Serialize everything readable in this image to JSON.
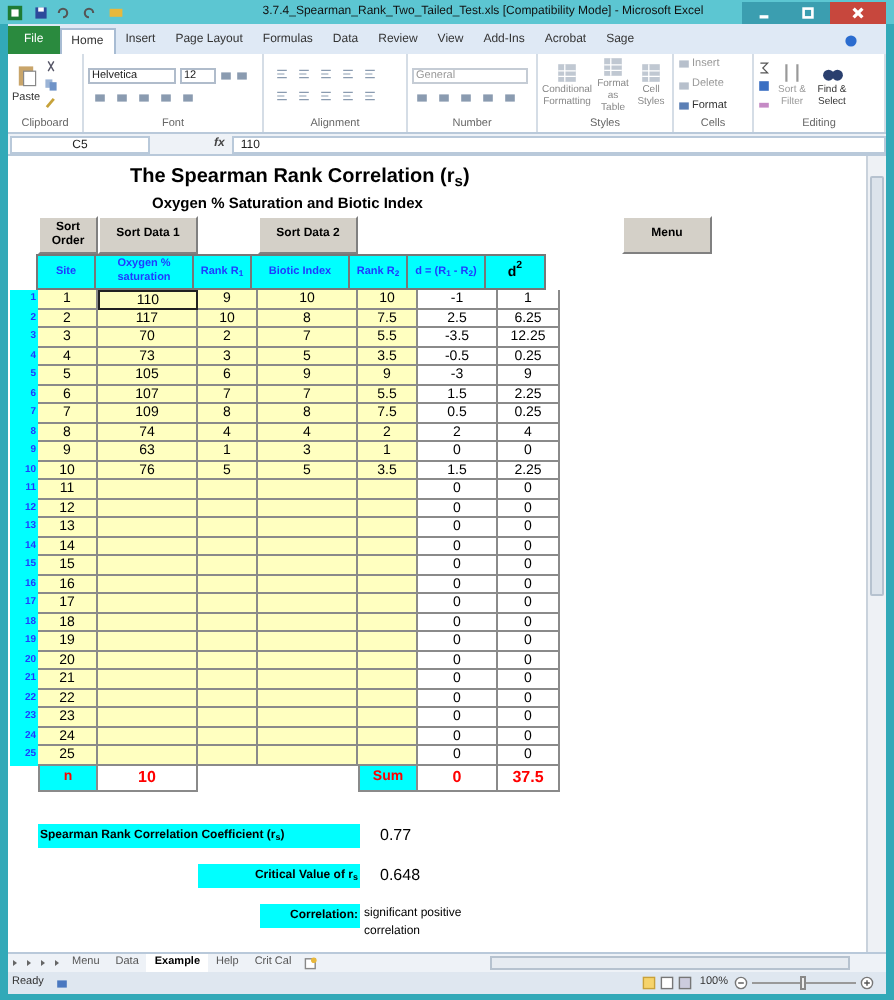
{
  "window": {
    "title": "3.7.4_Spearman_Rank_Two_Tailed_Test.xls  [Compatibility Mode]  -  Microsoft Excel"
  },
  "ribbon_tabs": [
    {
      "label": "File",
      "selected": false,
      "kind": "file"
    },
    {
      "label": "Home",
      "selected": true,
      "kind": "tab"
    },
    {
      "label": "Insert",
      "selected": false,
      "kind": "tab"
    },
    {
      "label": "Page Layout",
      "selected": false,
      "kind": "tab"
    },
    {
      "label": "Formulas",
      "selected": false,
      "kind": "tab"
    },
    {
      "label": "Data",
      "selected": false,
      "kind": "tab"
    },
    {
      "label": "Review",
      "selected": false,
      "kind": "tab"
    },
    {
      "label": "View",
      "selected": false,
      "kind": "tab"
    },
    {
      "label": "Add-Ins",
      "selected": false,
      "kind": "tab"
    },
    {
      "label": "Acrobat",
      "selected": false,
      "kind": "tab"
    },
    {
      "label": "Sage",
      "selected": false,
      "kind": "tab"
    }
  ],
  "ribbon": {
    "paste": "Paste",
    "font_name": "Helvetica",
    "font_size": "12",
    "number_format": "General",
    "styles_buttons": [
      "Conditional Formatting",
      "Format as Table",
      "Cell Styles"
    ],
    "cells_buttons": [
      "Insert",
      "Delete",
      "Format"
    ],
    "editing_buttons": [
      "Sort & Filter",
      "Find & Select"
    ],
    "groups": [
      {
        "label": "Clipboard"
      },
      {
        "label": "Font"
      },
      {
        "label": "Alignment"
      },
      {
        "label": "Number"
      },
      {
        "label": "Styles"
      },
      {
        "label": "Cells"
      },
      {
        "label": "Editing"
      }
    ]
  },
  "formula_bar": {
    "name_box": "C5",
    "fx": "fx",
    "value": "110"
  },
  "sheet": {
    "title": "The Spearman Rank Correlation (r$_{s}$)",
    "subtitle": "Oxygen % Saturation and Biotic Index",
    "buttons": [
      "Sort Order",
      "Sort Data 1",
      "Sort Data 2",
      "Menu"
    ],
    "columns": [
      "Site",
      "Oxygen % saturation",
      "Rank R$_{1}$",
      "Biotic Index",
      "Rank R$_{2}$",
      "d = (R$_{1}$ - R$_{2}$)",
      "d$^{2}$"
    ],
    "rows": [
      {
        "number": "1",
        "selected": true,
        "cells": [
          "1",
          "110",
          "9",
          "10",
          "10",
          "-1",
          "1"
        ]
      },
      {
        "number": "2",
        "selected": false,
        "cells": [
          "2",
          "117",
          "10",
          "8",
          "7.5",
          "2.5",
          "6.25"
        ]
      },
      {
        "number": "3",
        "selected": false,
        "cells": [
          "3",
          "70",
          "2",
          "7",
          "5.5",
          "-3.5",
          "12.25"
        ]
      },
      {
        "number": "4",
        "selected": false,
        "cells": [
          "4",
          "73",
          "3",
          "5",
          "3.5",
          "-0.5",
          "0.25"
        ]
      },
      {
        "number": "5",
        "selected": false,
        "cells": [
          "5",
          "105",
          "6",
          "9",
          "9",
          "-3",
          "9"
        ]
      },
      {
        "number": "6",
        "selected": false,
        "cells": [
          "6",
          "107",
          "7",
          "7",
          "5.5",
          "1.5",
          "2.25"
        ]
      },
      {
        "number": "7",
        "selected": false,
        "cells": [
          "7",
          "109",
          "8",
          "8",
          "7.5",
          "0.5",
          "0.25"
        ]
      },
      {
        "number": "8",
        "selected": false,
        "cells": [
          "8",
          "74",
          "4",
          "4",
          "2",
          "2",
          "4"
        ]
      },
      {
        "number": "9",
        "selected": false,
        "cells": [
          "9",
          "63",
          "1",
          "3",
          "1",
          "0",
          "0"
        ]
      },
      {
        "number": "10",
        "selected": false,
        "cells": [
          "10",
          "76",
          "5",
          "5",
          "3.5",
          "1.5",
          "2.25"
        ]
      },
      {
        "number": "11",
        "selected": false,
        "cells": [
          "11",
          null,
          null,
          null,
          null,
          "0",
          "0"
        ]
      },
      {
        "number": "12",
        "selected": false,
        "cells": [
          "12",
          null,
          null,
          null,
          null,
          "0",
          "0"
        ]
      },
      {
        "number": "13",
        "selected": false,
        "cells": [
          "13",
          null,
          null,
          null,
          null,
          "0",
          "0"
        ]
      },
      {
        "number": "14",
        "selected": false,
        "cells": [
          "14",
          null,
          null,
          null,
          null,
          "0",
          "0"
        ]
      },
      {
        "number": "15",
        "selected": false,
        "cells": [
          "15",
          null,
          null,
          null,
          null,
          "0",
          "0"
        ]
      },
      {
        "number": "16",
        "selected": false,
        "cells": [
          "16",
          null,
          null,
          null,
          null,
          "0",
          "0"
        ]
      },
      {
        "number": "17",
        "selected": false,
        "cells": [
          "17",
          null,
          null,
          null,
          null,
          "0",
          "0"
        ]
      },
      {
        "number": "18",
        "selected": false,
        "cells": [
          "18",
          null,
          null,
          null,
          null,
          "0",
          "0"
        ]
      },
      {
        "number": "19",
        "selected": false,
        "cells": [
          "19",
          null,
          null,
          null,
          null,
          "0",
          "0"
        ]
      },
      {
        "number": "20",
        "selected": false,
        "cells": [
          "20",
          null,
          null,
          null,
          null,
          "0",
          "0"
        ]
      },
      {
        "number": "21",
        "selected": false,
        "cells": [
          "21",
          null,
          null,
          null,
          null,
          "0",
          "0"
        ]
      },
      {
        "number": "22",
        "selected": false,
        "cells": [
          "22",
          null,
          null,
          null,
          null,
          "0",
          "0"
        ]
      },
      {
        "number": "23",
        "selected": false,
        "cells": [
          "23",
          null,
          null,
          null,
          null,
          "0",
          "0"
        ]
      },
      {
        "number": "24",
        "selected": false,
        "cells": [
          "24",
          null,
          null,
          null,
          null,
          "0",
          "0"
        ]
      },
      {
        "number": "25",
        "selected": false,
        "cells": [
          "25",
          null,
          null,
          null,
          null,
          "0",
          "0"
        ]
      }
    ],
    "totals": {
      "n_label": "n",
      "n_value": "10",
      "sum_label": "Sum",
      "sum_d": "0",
      "sum_d2": "37.5"
    },
    "results": [
      {
        "label": "Spearman Rank Correlation Coefficient (r$_{s}$)",
        "value": "0.77"
      },
      {
        "label": "Critical Value of r$_{s}$",
        "value": "0.648"
      },
      {
        "label": "Correlation:",
        "value": "significant positive correlation"
      }
    ]
  },
  "sheet_tabs": [
    {
      "label": "Menu",
      "selected": false
    },
    {
      "label": "Data",
      "selected": false
    },
    {
      "label": "Example",
      "selected": true
    },
    {
      "label": "Help",
      "selected": false
    },
    {
      "label": "Crit Cal",
      "selected": false
    }
  ],
  "status_bar": {
    "status": "Ready",
    "zoom": "100%"
  }
}
